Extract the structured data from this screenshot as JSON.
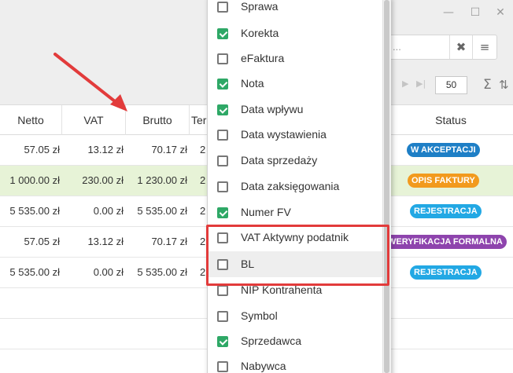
{
  "window": {
    "minimize_icon": "minimize-icon",
    "maximize_icon": "maximize-icon",
    "close_icon": "close-icon"
  },
  "search": {
    "ellipsis": "...",
    "clear_glyph": "✖",
    "menu_glyph": "≡"
  },
  "pager": {
    "next_glyph": "▶",
    "last_glyph": "▶|",
    "page_size": "50",
    "sum_glyph": "Σ",
    "sort_glyph": "⇅"
  },
  "table": {
    "headers": {
      "netto": "Netto",
      "vat": "VAT",
      "brutto": "Brutto",
      "ter": "Ter",
      "status": "Status"
    },
    "rows": [
      {
        "netto": "57.05 zł",
        "vat": "13.12 zł",
        "brutto": "70.17 zł",
        "ter": "2",
        "status": "W AKCEPTACJI",
        "status_color": "#1e7fc6"
      },
      {
        "netto": "1 000.00 zł",
        "vat": "230.00 zł",
        "brutto": "1 230.00 zł",
        "ter": "2",
        "status": "OPIS FAKTURY",
        "status_color": "#f29a1e"
      },
      {
        "netto": "5 535.00 zł",
        "vat": "0.00 zł",
        "brutto": "5 535.00 zł",
        "ter": "2",
        "status": "REJESTRACJA",
        "status_color": "#22a8e4"
      },
      {
        "netto": "57.05 zł",
        "vat": "13.12 zł",
        "brutto": "70.17 zł",
        "ter": "2",
        "status": "WERYFIKACJA FORMALNA",
        "status_color": "#8e44ad"
      },
      {
        "netto": "5 535.00 zł",
        "vat": "0.00 zł",
        "brutto": "5 535.00 zł",
        "ter": "2",
        "status": "REJESTRACJA",
        "status_color": "#22a8e4"
      }
    ]
  },
  "column_chooser": {
    "options": [
      {
        "label": "Sprawa",
        "checked": false
      },
      {
        "label": "Korekta",
        "checked": true
      },
      {
        "label": "eFaktura",
        "checked": false
      },
      {
        "label": "Nota",
        "checked": true
      },
      {
        "label": "Data wpływu",
        "checked": true
      },
      {
        "label": "Data wystawienia",
        "checked": false
      },
      {
        "label": "Data sprzedaży",
        "checked": false
      },
      {
        "label": "Data zaksięgowania",
        "checked": false
      },
      {
        "label": "Numer FV",
        "checked": true
      },
      {
        "label": "VAT Aktywny podatnik",
        "checked": false
      },
      {
        "label": "BL",
        "checked": false
      },
      {
        "label": "NIP Kontrahenta",
        "checked": false
      },
      {
        "label": "Symbol",
        "checked": false
      },
      {
        "label": "Sprzedawca",
        "checked": true
      },
      {
        "label": "Nabywca",
        "checked": false
      }
    ]
  },
  "colors": {
    "check_green": "#2ea866",
    "annotation_red": "#e23b3b",
    "row_highlight": "#e7f3d7"
  }
}
